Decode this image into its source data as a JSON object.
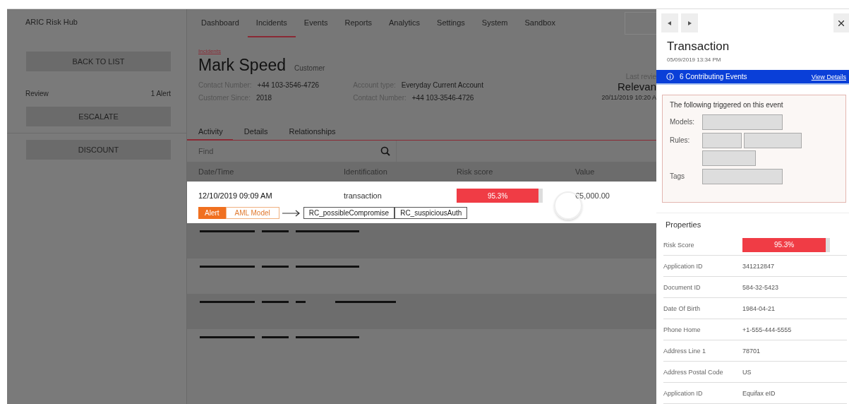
{
  "app_name": "ARIC Risk Hub",
  "sidebar": {
    "back_button": "BACK TO LIST",
    "review_label": "Review",
    "review_count": "1 Alert",
    "buttons": [
      "ESCALATE",
      "DISCOUNT"
    ]
  },
  "nav": [
    {
      "label": "Dashboard",
      "selected": false
    },
    {
      "label": "Incidents",
      "selected": true
    },
    {
      "label": "Events",
      "selected": false
    },
    {
      "label": "Reports",
      "selected": false
    },
    {
      "label": "Analytics",
      "selected": false
    },
    {
      "label": "Settings",
      "selected": false
    },
    {
      "label": "System",
      "selected": false
    },
    {
      "label": "Sandbox",
      "selected": false
    }
  ],
  "header": {
    "breadcrumb": "Incidents",
    "name": "Mark Speed",
    "role": "Customer",
    "info_left": [
      {
        "label": "Contact Number:",
        "value": "+44 103-3546-4726"
      },
      {
        "label": "Customer Since:",
        "value": "2018"
      }
    ],
    "info_right": [
      {
        "label": "Account type:",
        "value": "Everyday Current Account"
      },
      {
        "label": "Contact Number:",
        "value": "+44 103-3546-4726"
      }
    ],
    "last_review_label": "Last revie",
    "last_review_value": "Relevan",
    "last_review_date": "20/11/2019 10:20 A"
  },
  "tabs": [
    {
      "label": "Activity",
      "selected": true
    },
    {
      "label": "Details",
      "selected": false
    },
    {
      "label": "Relationships",
      "selected": false
    }
  ],
  "search": {
    "placeholder": "Find"
  },
  "table": {
    "columns": [
      "Date/Time",
      "Identification",
      "Risk score",
      "Value"
    ],
    "rows": [
      {
        "datetime": "12/10/2019 09:09 AM",
        "identification": "transaction",
        "risk": "95.3%",
        "level": 0.953,
        "value": "€5,000.00",
        "alert": "Alert",
        "model": "AML Model",
        "rules": [
          "RC_possibleCompromise",
          "RC_suspiciousAuth"
        ]
      }
    ]
  },
  "panel": {
    "title": "Transaction",
    "date": "05/09/2019 13:34 PM",
    "banner": "6 Contributing Events",
    "banner_link": "View Details",
    "trigger_heading": "The following triggered on this event",
    "trigger_labels": [
      "Models:",
      "Rules:",
      "Tags"
    ],
    "properties_heading": "Properties",
    "risk_label": "Risk Score",
    "risk": "95.3%",
    "level": 0.953,
    "properties": [
      {
        "label": "Application ID",
        "value": "341212847"
      },
      {
        "label": "Document ID",
        "value": "584-32-5423"
      },
      {
        "label": "Date Of Birth",
        "value": "1984-04-21"
      },
      {
        "label": "Phone Home",
        "value": "+1-555-444-5555"
      },
      {
        "label": "Address Line 1",
        "value": "78701"
      },
      {
        "label": "Address Postal Code",
        "value": "US"
      },
      {
        "label": "Application ID",
        "value": "Equifax eID"
      }
    ]
  }
}
